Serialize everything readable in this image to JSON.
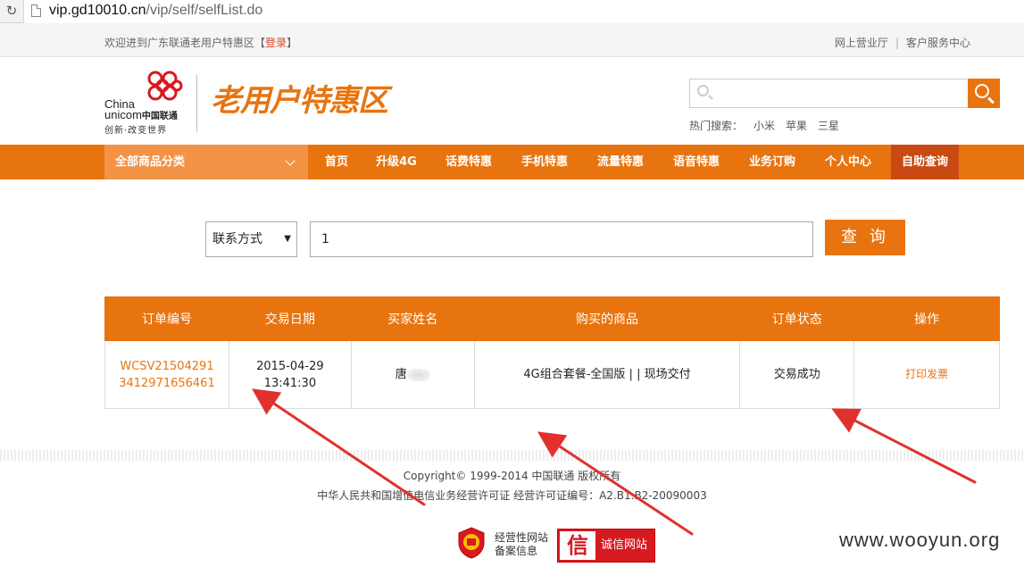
{
  "browser": {
    "url_host": "vip.gd10010.cn",
    "url_path": "/vip/self/selfList.do"
  },
  "topbar": {
    "welcome": "欢迎进到广东联通老用户特惠区【",
    "login": "登录",
    "welcome_end": "】",
    "links": [
      "网上营业厅",
      "客户服务中心"
    ]
  },
  "header": {
    "logo_china": "China",
    "logo_unicom": "unicom",
    "logo_cn": "中国联通",
    "logo_slogan": "创新·改变世界",
    "zone_title": "老用户特惠区",
    "search_placeholder": "",
    "hot_label": "热门搜索：",
    "hot_keywords": [
      "小米",
      "苹果",
      "三星"
    ]
  },
  "nav": {
    "category": "全部商品分类",
    "items": [
      "首页",
      "升级4G",
      "话费特惠",
      "手机特惠",
      "流量特惠",
      "语音特惠",
      "业务订购",
      "个人中心",
      "自助查询"
    ],
    "active_index": 8
  },
  "query": {
    "select_value": "联系方式",
    "input_value": "1",
    "button": "查 询"
  },
  "table": {
    "headers": [
      "订单编号",
      "交易日期",
      "买家姓名",
      "购买的商品",
      "订单状态",
      "操作"
    ],
    "rows": [
      {
        "order_no_1": "WCSV21504291",
        "order_no_2": "3412971656461",
        "date": "2015-04-29",
        "time": "13:41:30",
        "buyer": "唐",
        "product": "4G组合套餐-全国版 | | 现场交付",
        "status": "交易成功",
        "action": "打印发票"
      }
    ]
  },
  "footer": {
    "copyright": "Copyright© 1999-2014 中国联通 版权所有",
    "license": "中华人民共和国增值电信业务经营许可证 经营许可证编号：A2.B1.B2-20090003",
    "badge1_line1": "经营性网站",
    "badge1_line2": "备案信息",
    "badge2_icon": "信",
    "badge2_text": "诚信网站"
  },
  "watermark": "www.wooyun.org",
  "colors": {
    "brand_orange": "#e8740f",
    "active_nav": "#c84a12",
    "annotation_red": "#e0312f"
  }
}
